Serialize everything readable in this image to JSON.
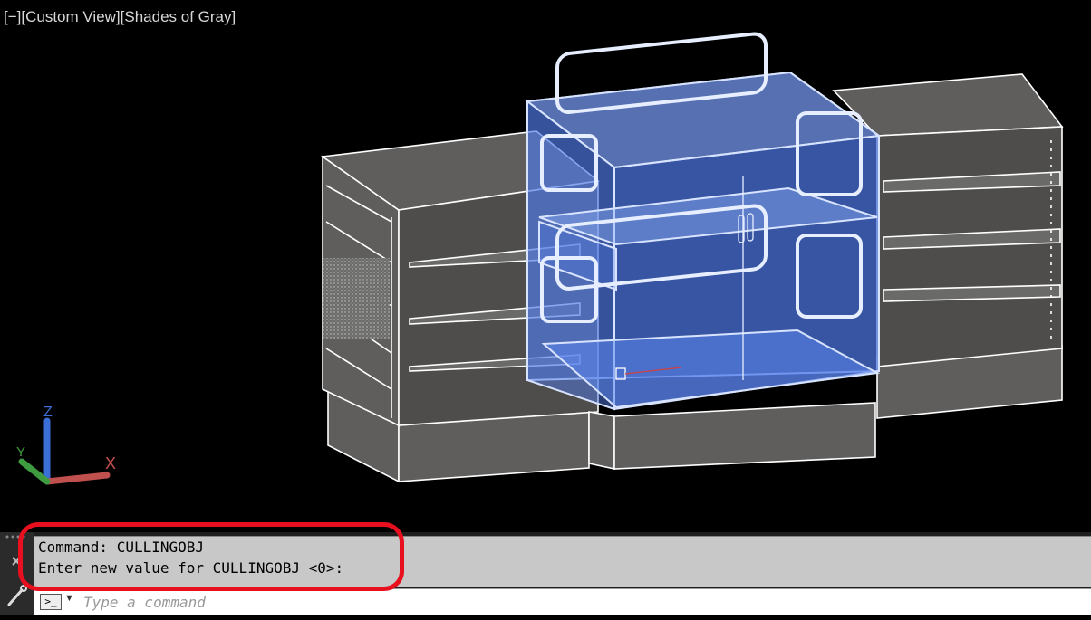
{
  "viewport": {
    "controls": {
      "minus": "[−]",
      "view": "[Custom View]",
      "style": "[Shades of Gray]"
    },
    "ucs": {
      "x_label": "X",
      "y_label": "Y",
      "z_label": "Z"
    }
  },
  "command_line": {
    "history": [
      "Command: CULLINGOBJ",
      "Enter new value for CULLINGOBJ <0>:"
    ],
    "prompt_icon": ">_",
    "placeholder": "Type a command"
  },
  "colors": {
    "highlight": "#e8101e",
    "selection": "#4f79e6",
    "model_fill": "#5f5e5c",
    "ucs_x": "#c0504d",
    "ucs_y": "#3f9b40",
    "ucs_z": "#3b6fd8"
  },
  "icons": [
    "ucs-icon",
    "command-prompt-icon",
    "dropdown-arrow-icon",
    "wrench-icon",
    "close-icon"
  ]
}
